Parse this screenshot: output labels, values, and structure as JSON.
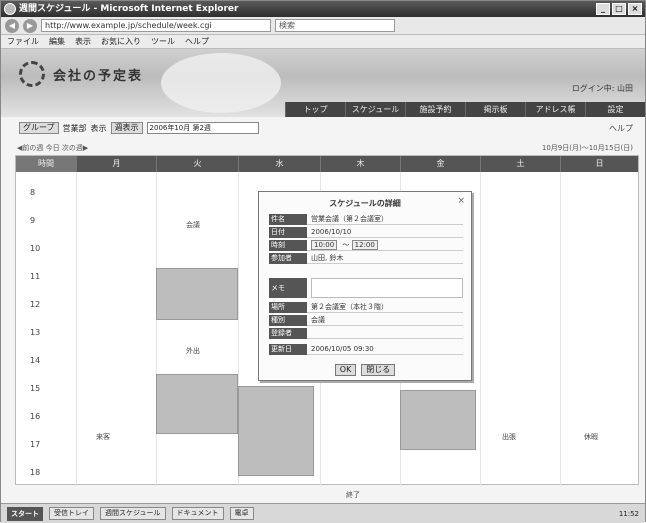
{
  "window": {
    "title": "週間スケジュール - Microsoft Internet Explorer",
    "controls": [
      "_",
      "□",
      "×"
    ]
  },
  "address": {
    "back": "◀",
    "forward": "▶",
    "url": "http://www.example.jp/schedule/week.cgi",
    "search_placeholder": "検索"
  },
  "menu": [
    "ファイル",
    "編集",
    "表示",
    "お気に入り",
    "ツール",
    "ヘルプ"
  ],
  "banner": {
    "site_name": "会社の予定表",
    "user_info": "ログイン中: 山田"
  },
  "topnav": [
    "トップ",
    "スケジュール",
    "施設予約",
    "掲示板",
    "アドレス帳",
    "設定"
  ],
  "filter": {
    "btn1": "グループ",
    "label1": "営業部",
    "label2": "表示",
    "btn2": "週表示",
    "field": "2006年10月 第2週",
    "help": "ヘルプ"
  },
  "subinfo": {
    "left": "◀前の週  今日  次の週▶",
    "right": "10月9日(月)〜10月15日(日)"
  },
  "grid": {
    "columns": [
      "時間",
      "月",
      "火",
      "水",
      "木",
      "金",
      "土",
      "日"
    ],
    "hours": [
      "8",
      "9",
      "10",
      "11",
      "12",
      "13",
      "14",
      "15",
      "16",
      "17",
      "18"
    ],
    "labels": {
      "l1": "会議",
      "l2": "外出",
      "l3": "来客",
      "l4": "出張",
      "l5": "休暇",
      "l6": "終了"
    }
  },
  "dialog": {
    "title": "スケジュールの詳細",
    "close": "×",
    "rows": [
      {
        "label": "件名",
        "value": "営業会議（第２会議室）"
      },
      {
        "label": "日付",
        "value": "2006/10/10"
      },
      {
        "label": "時刻",
        "t1": "10:00",
        "sep": "〜",
        "t2": "12:00"
      },
      {
        "label": "参加者",
        "value": "山田, 鈴木"
      },
      {
        "label": "メモ",
        "value": ""
      },
      {
        "label": "場所",
        "value": "第２会議室（本社３階）"
      },
      {
        "label": "種別",
        "value": "会議"
      },
      {
        "label": "登録者",
        "value": ""
      },
      {
        "label": "更新日",
        "value": "2006/10/05 09:30"
      }
    ],
    "ok": "OK",
    "cancel": "閉じる"
  },
  "taskbar": {
    "start": "スタート",
    "tasks": [
      "受信トレイ",
      "週間スケジュール",
      "ドキュメント",
      "電卓"
    ],
    "clock": "11:52"
  }
}
